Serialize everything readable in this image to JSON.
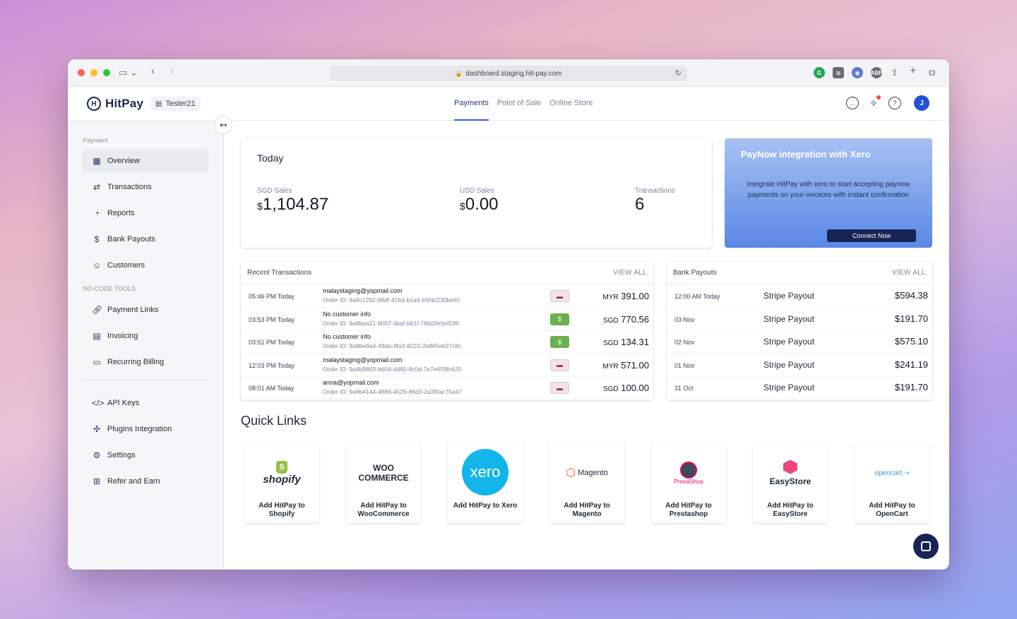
{
  "browser": {
    "url": "dashboard.staging.hit-pay.com"
  },
  "header": {
    "brand": "HitPay",
    "store": "Tester21",
    "tabs": [
      {
        "label": "Payments",
        "active": true
      },
      {
        "label": "Point of Sale",
        "active": false
      },
      {
        "label": "Online Store",
        "active": false
      }
    ],
    "avatar_initial": "J"
  },
  "sidebar": {
    "section_payment": "Payment",
    "section_nocode": "NO-CODE TOOLS",
    "items": [
      {
        "label": "Overview",
        "icon": "grid-icon"
      },
      {
        "label": "Transactions",
        "icon": "arrows-icon"
      },
      {
        "label": "Reports",
        "icon": "pie-chart-icon"
      },
      {
        "label": "Bank Payouts",
        "icon": "dollar-doc-icon"
      },
      {
        "label": "Customers",
        "icon": "users-icon"
      },
      {
        "label": "Payment Links",
        "icon": "link-icon"
      },
      {
        "label": "Invoicing",
        "icon": "invoice-icon"
      },
      {
        "label": "Recurring Billing",
        "icon": "recurring-icon"
      },
      {
        "label": "API Keys",
        "icon": "code-icon"
      },
      {
        "label": "Plugins Integration",
        "icon": "puzzle-icon"
      },
      {
        "label": "Settings",
        "icon": "gear-icon"
      },
      {
        "label": "Refer and Earn",
        "icon": "gift-icon"
      }
    ]
  },
  "today": {
    "title": "Today",
    "sgd_label": "SGD Sales",
    "sgd_cur": "$",
    "sgd_value": "1,104.87",
    "usd_label": "USD Sales",
    "usd_cur": "$",
    "usd_value": "0.00",
    "tx_label": "Transactions",
    "tx_value": "6"
  },
  "promo": {
    "title": "PayNow integration with Xero",
    "text": "Integrate HitPay with xero to start accepting paynow payments on your invoices with instant confirmation",
    "button": "Connect Now"
  },
  "recent": {
    "title": "Recent Transactions",
    "view_all": "VIEW ALL",
    "rows": [
      {
        "time": "05:46 PM Today",
        "who": "malaystaging@yopmail.com",
        "order": "Order ID: 9a8c1292-98df-416d-b1a4-b5fdc230be65",
        "method": "card",
        "cur": "MYR",
        "amount": "391.00"
      },
      {
        "time": "03:53 PM Today",
        "who": "No customer info",
        "order": "Order ID: 9a8bea21-8007-4baf-b61f-786d3e5ef189",
        "method": "cash",
        "cur": "SGD",
        "amount": "770.56"
      },
      {
        "time": "03:51 PM Today",
        "who": "No customer info",
        "order": "Order ID: 9a8be9a4-49da-4fa3-8223-2e865eb27c8c",
        "method": "cash",
        "cur": "SGD",
        "amount": "134.31"
      },
      {
        "time": "12:03 PM Today",
        "who": "malaystaging@yopmail.com",
        "order": "Order ID: 9a8b9803-b604-4d80-8c0d-7e7e659fc620",
        "method": "card",
        "cur": "MYR",
        "amount": "571.00"
      },
      {
        "time": "08:01 AM Today",
        "who": "anna@yopmail.com",
        "order": "Order ID: 9a8b4144-4689-4529-86d3-2a3f0ac75a47",
        "method": "card",
        "cur": "SGD",
        "amount": "100.00"
      }
    ]
  },
  "payouts": {
    "title": "Bank Payouts",
    "view_all": "VIEW ALL",
    "rows": [
      {
        "date": "12:00 AM Today",
        "type": "Stripe Payout",
        "amount": "$594.38"
      },
      {
        "date": "03 Nov",
        "type": "Stripe Payout",
        "amount": "$191.70"
      },
      {
        "date": "02 Nov",
        "type": "Stripe Payout",
        "amount": "$575.10"
      },
      {
        "date": "01 Nov",
        "type": "Stripe Payout",
        "amount": "$241.19"
      },
      {
        "date": "31 Oct",
        "type": "Stripe Payout",
        "amount": "$191.70"
      }
    ]
  },
  "quick_links": {
    "title": "Quick Links",
    "items": [
      {
        "logo": "shopify",
        "label": "Add HitPay to Shopify"
      },
      {
        "logo": "WOO COMMERCE",
        "label": "Add HitPay to WooCommerce"
      },
      {
        "logo": "xero",
        "label": "Add HitPay to Xero"
      },
      {
        "logo": "Magento",
        "label": "Add HitPay to Magento"
      },
      {
        "logo": "PrestaShop",
        "label": "Add HitPay to Prestashop"
      },
      {
        "logo": "EasyStore",
        "label": "Add HitPay to EasyStore"
      },
      {
        "logo": "opencart",
        "label": "Add HitPay to OpenCart"
      }
    ]
  },
  "colors": {
    "accent": "#2563eb",
    "navy": "#172554",
    "sidebar_bg": "#f5f6f8"
  }
}
